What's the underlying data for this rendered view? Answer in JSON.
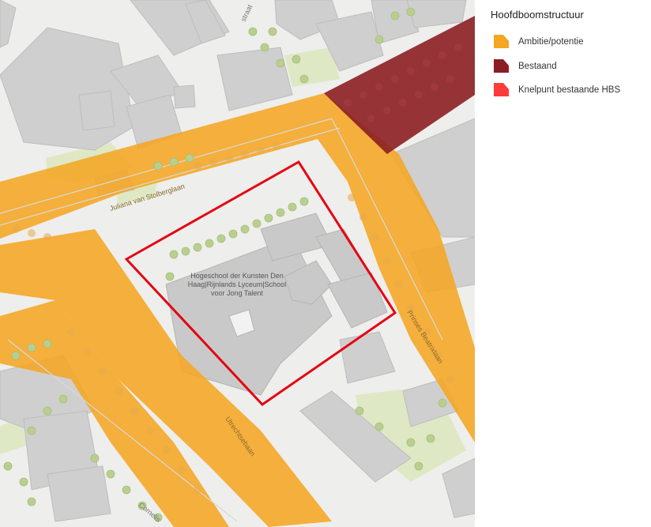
{
  "legend": {
    "title": "Hoofdboomstructuur",
    "items": [
      {
        "label": "Ambitie/potentie",
        "color": "#f5a623",
        "icon": "polygon-swatch"
      },
      {
        "label": "Bestaand",
        "color": "#8b1e24",
        "icon": "polygon-swatch"
      },
      {
        "label": "Knelpunt bestaande HBS",
        "color": "#ff3b3b",
        "icon": "polygon-swatch"
      }
    ]
  },
  "map": {
    "school_label_lines": [
      "Hogeschool der Kunsten Den",
      "Haag|Rijnlands Lyceum|School",
      "voor Jong Talent"
    ],
    "streets": {
      "juliana": "Juliana van Stolberglaan",
      "prinses": "Prinses Beatrixlaan",
      "utrecht": "Utrechtsebaan",
      "cornelis": "Cornelis",
      "top": "straat"
    },
    "colors": {
      "background": "#eeeeec",
      "building": "#cfcfcf",
      "green": "#dfe8c4",
      "tree": "#b9cf8f",
      "ambition": "#f5a623",
      "existing": "#8b1e24",
      "outline": "#e30613"
    }
  }
}
